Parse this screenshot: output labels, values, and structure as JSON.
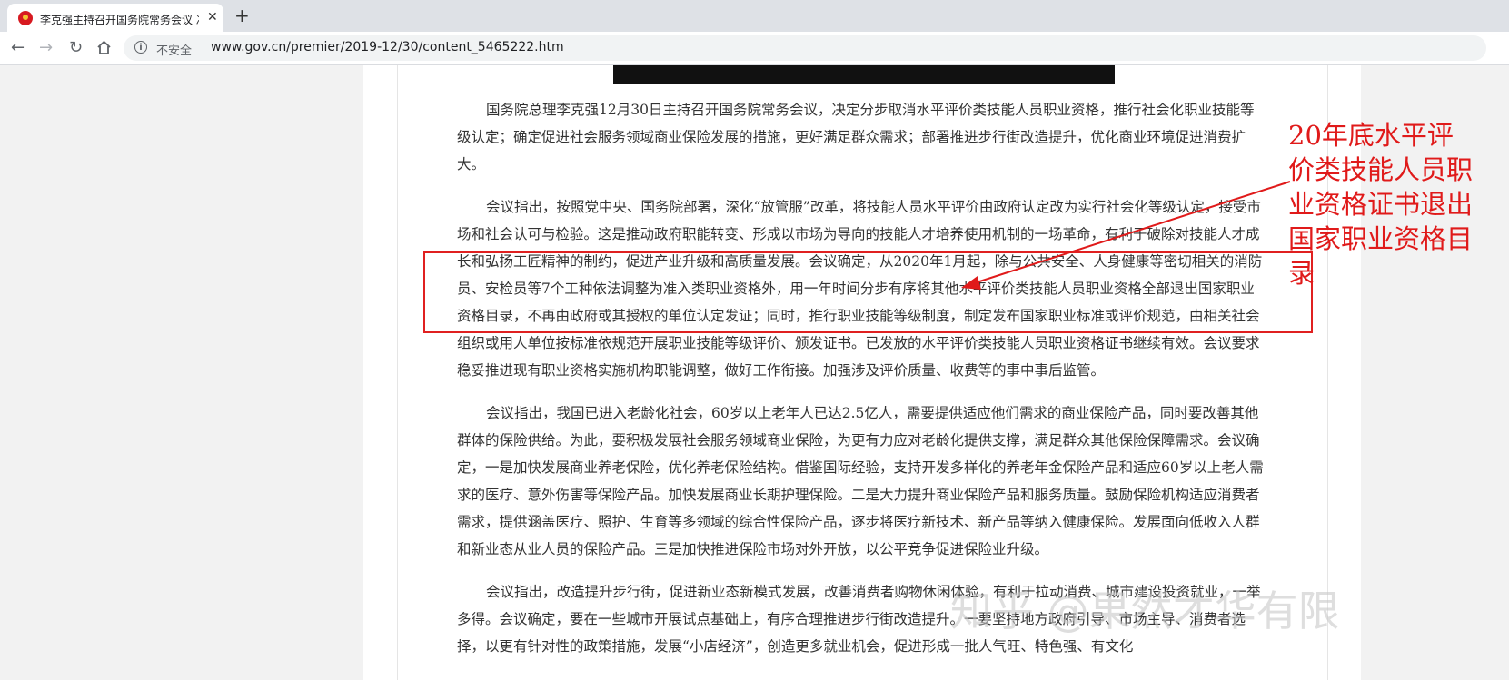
{
  "tab": {
    "title": "李克强主持召开国务院常务会议 决"
  },
  "toolbar": {
    "security_label": "不安全",
    "url": "www.gov.cn/premier/2019-12/30/content_5465222.htm"
  },
  "article": {
    "paragraphs": [
      "国务院总理李克强12月30日主持召开国务院常务会议，决定分步取消水平评价类技能人员职业资格，推行社会化职业技能等级认定；确定促进社会服务领域商业保险发展的措施，更好满足群众需求；部署推进步行街改造提升，优化商业环境促进消费扩大。",
      "会议指出，按照党中央、国务院部署，深化“放管服”改革，将技能人员水平评价由政府认定改为实行社会化等级认定，接受市场和社会认可与检验。这是推动政府职能转变、形成以市场为导向的技能人才培养使用机制的一场革命，有利于破除对技能人才成长和弘扬工匠精神的制约，促进产业升级和高质量发展。会议确定，从2020年1月起，除与公共安全、人身健康等密切相关的消防员、安检员等7个工种依法调整为准入类职业资格外，用一年时间分步有序将其他水平评价类技能人员职业资格全部退出国家职业资格目录，不再由政府或其授权的单位认定发证；同时，推行职业技能等级制度，制定发布国家职业标准或评价规范，由相关社会组织或用人单位按标准依规范开展职业技能等级评价、颁发证书。已发放的水平评价类技能人员职业资格证书继续有效。会议要求稳妥推进现有职业资格实施机构职能调整，做好工作衔接。加强涉及评价质量、收费等的事中事后监管。",
      "会议指出，我国已进入老龄化社会，60岁以上老年人已达2.5亿人，需要提供适应他们需求的商业保险产品，同时要改善其他群体的保险供给。为此，要积极发展社会服务领域商业保险，为更有力应对老龄化提供支撑，满足群众其他保险保障需求。会议确定，一是加快发展商业养老保险，优化养老保险结构。借鉴国际经验，支持开发多样化的养老年金保险产品和适应60岁以上老人需求的医疗、意外伤害等保险产品。加快发展商业长期护理保险。二是大力提升商业保险产品和服务质量。鼓励保险机构适应消费者需求，提供涵盖医疗、照护、生育等多领域的综合性保险产品，逐步将医疗新技术、新产品等纳入健康保险。发展面向低收入人群和新业态从业人员的保险产品。三是加快推进保险市场对外开放，以公平竞争促进保险业升级。",
      "会议指出，改造提升步行街，促进新业态新模式发展，改善消费者购物休闲体验，有利于拉动消费、城市建设投资就业，一举多得。会议确定，要在一些城市开展试点基础上，有序合理推进步行街改造提升。一要坚持地方政府引导、市场主导、消费者选择，以更有针对性的政策措施，发展“小店经济”，创造更多就业机会，促进形成一批人气旺、特色强、有文化"
    ]
  },
  "annotation": {
    "text": "20年底水平评价类技能人员职业资格证书退出国家职业资格目录"
  },
  "watermark": {
    "text": "知乎 @果然才华有限"
  }
}
